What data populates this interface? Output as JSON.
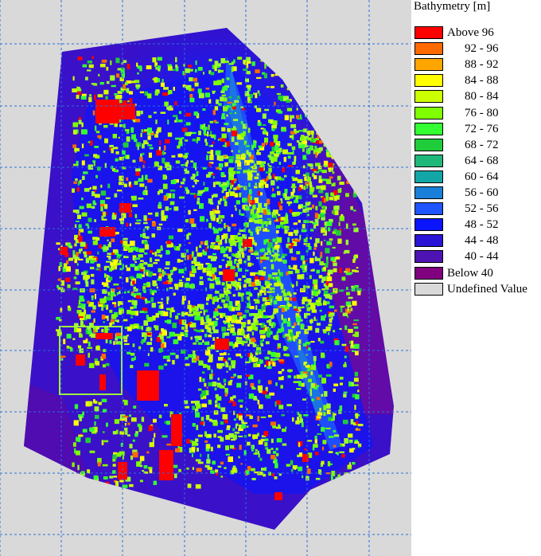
{
  "legend": {
    "title": "Bathymetry [m]",
    "entries": [
      {
        "label": "Above 96",
        "color": "#ff0000"
      },
      {
        "label": "92 - 96",
        "color": "#ff6a00"
      },
      {
        "label": "88 - 92",
        "color": "#ffa500"
      },
      {
        "label": "84 - 88",
        "color": "#ffff00"
      },
      {
        "label": "80 - 84",
        "color": "#ccff00"
      },
      {
        "label": "76 - 80",
        "color": "#80ff00"
      },
      {
        "label": "72 - 76",
        "color": "#33ff33"
      },
      {
        "label": "68 - 72",
        "color": "#1fcc3a"
      },
      {
        "label": "64 - 68",
        "color": "#1fb87a"
      },
      {
        "label": "60 - 64",
        "color": "#12a6a6"
      },
      {
        "label": "56 - 60",
        "color": "#1a7fd9"
      },
      {
        "label": "52 - 56",
        "color": "#1f55ff"
      },
      {
        "label": "48 - 52",
        "color": "#0a14ff"
      },
      {
        "label": "44 - 48",
        "color": "#2a14d6"
      },
      {
        "label": "40 - 44",
        "color": "#4d14b3"
      },
      {
        "label": "Below 40",
        "color": "#800080"
      },
      {
        "label": "Undefined Value",
        "color": "#d9d9d9"
      }
    ]
  },
  "map": {
    "background_color": "#d9d9d9",
    "grid_color": "#2a6fd6"
  }
}
